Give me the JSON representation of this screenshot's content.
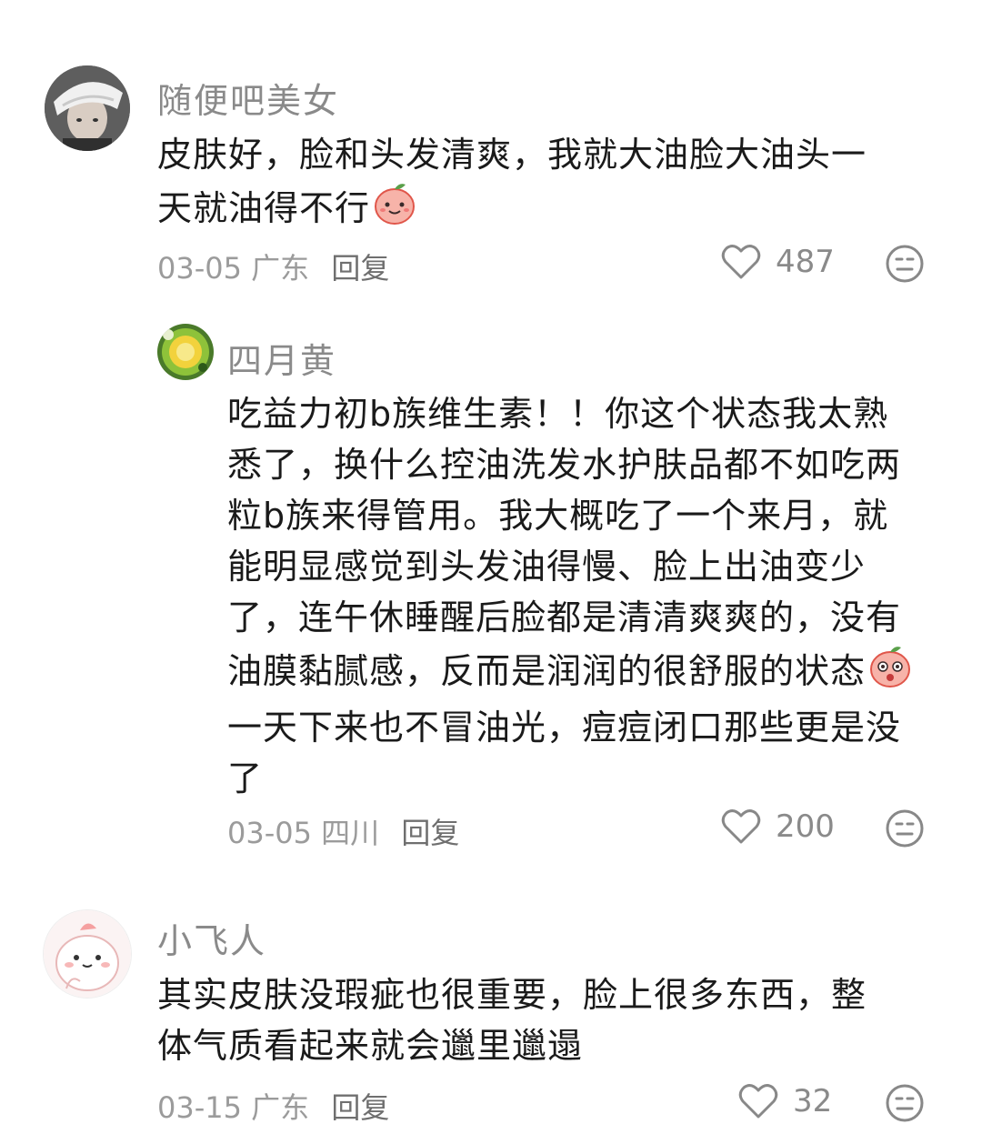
{
  "comments": [
    {
      "username": "随便吧美女",
      "content_line1": "皮肤好，脸和头发清爽，我就大油脸大油头一",
      "content_line2": "天就油得不行",
      "date": "03-05",
      "location": "广东",
      "reply_label": "回复",
      "likes": "487",
      "emoji": "peach-smile"
    },
    {
      "username": "四月黄",
      "content_part1": "吃益力初b族维生素！！你这个状态我太熟悉了，换什么控油洗发水护肤品都不如吃两粒b族来得管用。我大概吃了一个来月，就能明显感觉到头发油得慢、脸上出油变少了，连午休睡醒后脸都是清清爽爽的，没有油膜黏腻感，反而是润润的很舒服的状态",
      "content_part2": "一天下来也不冒油光，痘痘闭口那些更是没了",
      "date": "03-05",
      "location": "四川",
      "reply_label": "回复",
      "likes": "200",
      "emoji": "peach-wow"
    },
    {
      "username": "小飞人",
      "content_line1": "其实皮肤没瑕疵也很重要，脸上很多东西，整",
      "content_line2": "体气质看起来就会邋里邋遢",
      "date": "03-15",
      "location": "广东",
      "reply_label": "回复",
      "likes": "32"
    }
  ],
  "colors": {
    "text": "#1a1a1a",
    "muted": "#8a8a8a",
    "icon": "#888888"
  }
}
